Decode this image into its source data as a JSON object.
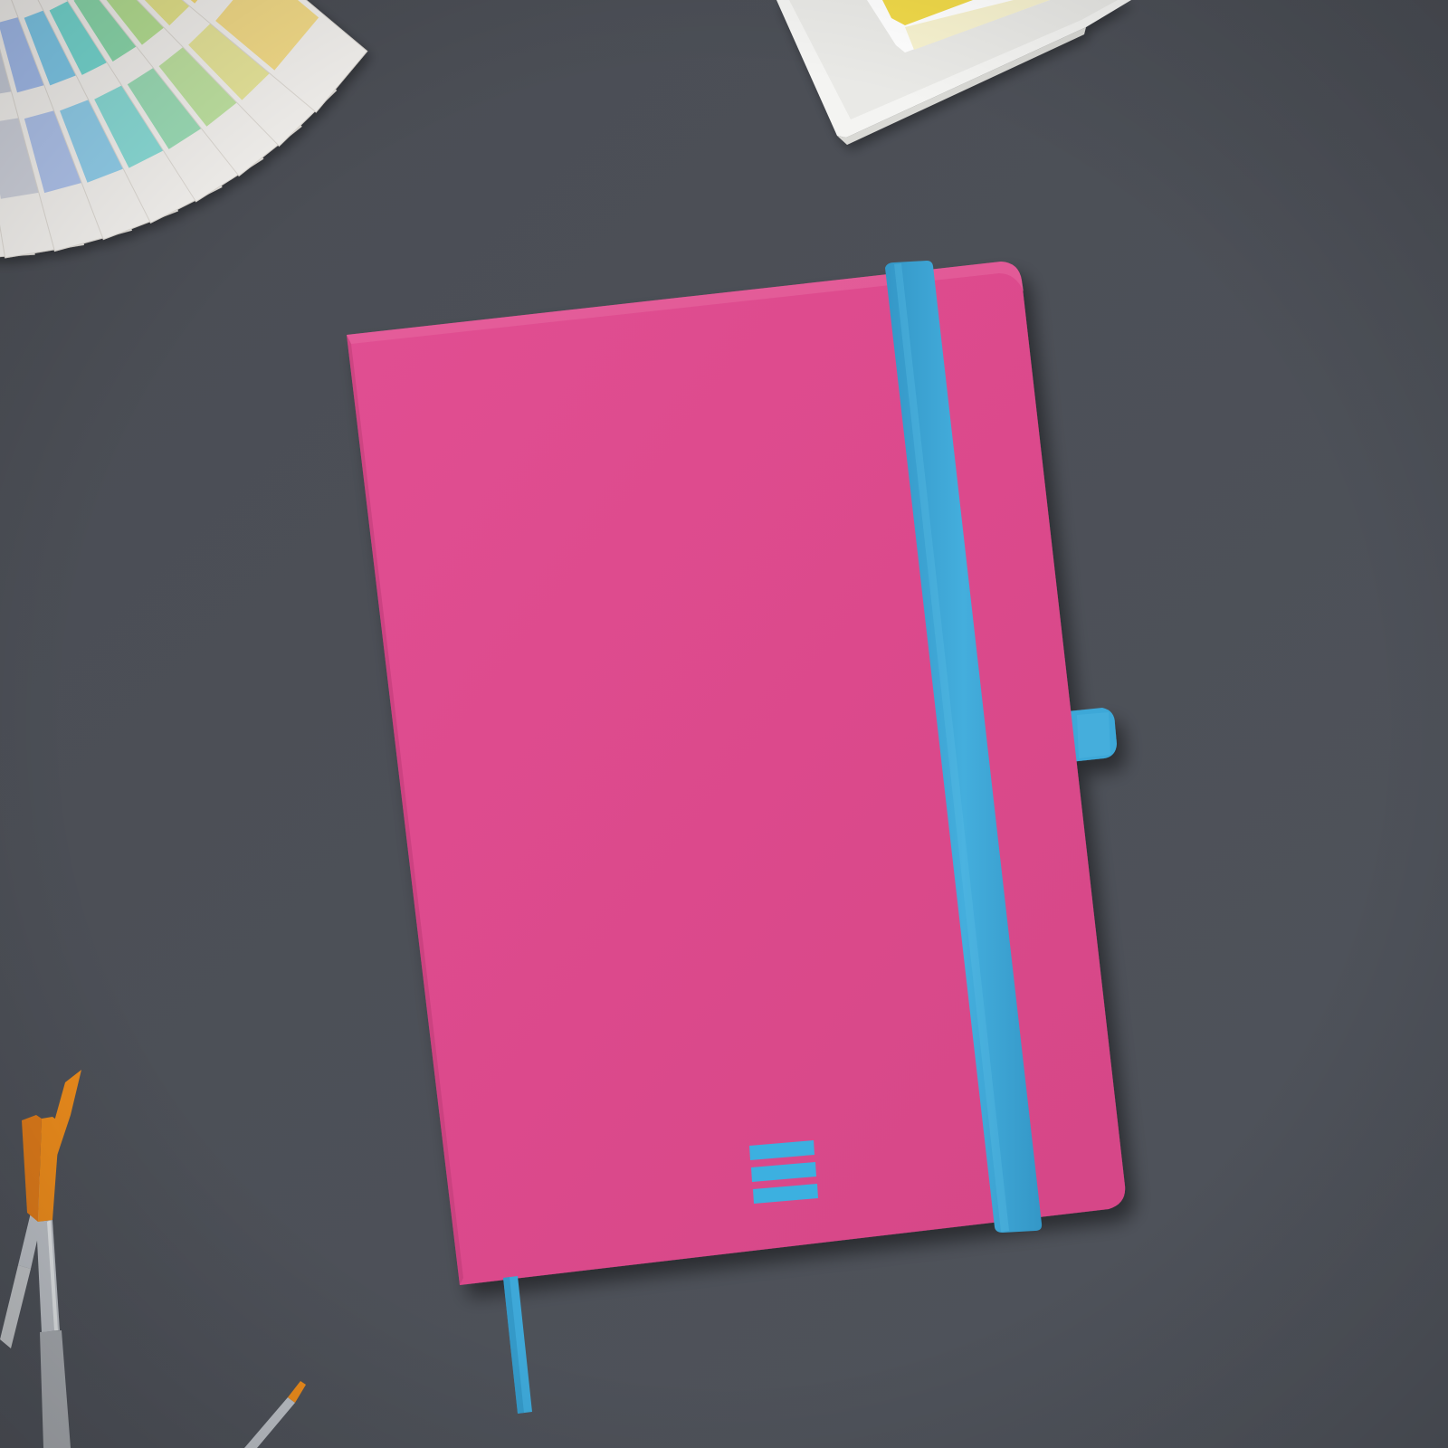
{
  "scene": {
    "colors": {
      "background_top": "#4a4d54",
      "background_bottom": "#4f535b",
      "notebook_cover": "#dc4a8c",
      "notebook_cover_shade": "#c83f7d",
      "elastic_band": "#3fa6d6",
      "bookmark_ribbon": "#3ea8d8",
      "logo_mark": "#3cb0e0",
      "pen_loop": "#3ea8d8",
      "swatch_paper": "#f3f1ee",
      "paint_tray": "#f4f4f2",
      "brush_bristles": "#e98a1c",
      "brush_ferrule": "#b8bcc2"
    },
    "swatch_fan_colors": [
      "#d1b3cb",
      "#b8a6d8",
      "#a9b0e2",
      "#c4c9d6",
      "#9eb8ea",
      "#78c6e8",
      "#6fd6cf",
      "#86d7a8",
      "#b2de8d",
      "#e3e285",
      "#f2d66e"
    ],
    "paint_pan_colors": [
      "#f0d94a",
      "#f7f2cf"
    ]
  },
  "objects": {
    "notebook": {
      "icon": "notebook-icon"
    },
    "logo": {
      "icon": "three-bar-logo-icon"
    },
    "band": {
      "icon": "elastic-band-icon"
    },
    "ribbon": {
      "icon": "bookmark-ribbon-icon"
    },
    "pen_loop": {
      "icon": "pen-loop-icon"
    },
    "swatches": {
      "icon": "color-swatch-fan-icon"
    },
    "paint_box": {
      "icon": "watercolor-tray-icon"
    },
    "brushes": {
      "icon": "paint-brush-icon"
    }
  }
}
